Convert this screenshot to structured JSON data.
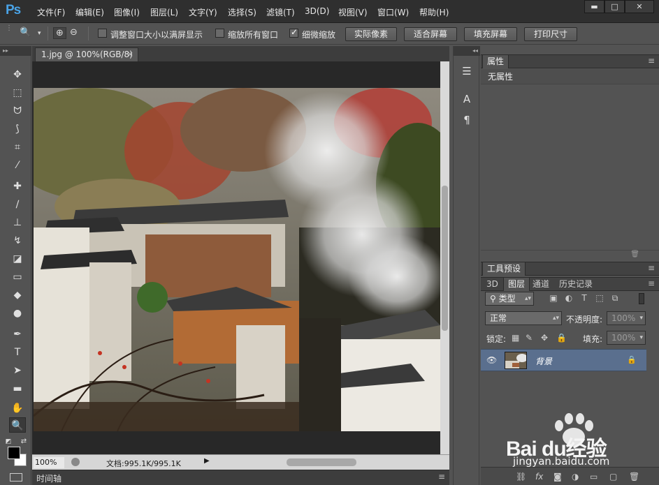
{
  "app": {
    "logo": "Ps"
  },
  "menu": [
    "文件(F)",
    "编辑(E)",
    "图像(I)",
    "图层(L)",
    "文字(Y)",
    "选择(S)",
    "滤镜(T)",
    "3D(D)",
    "视图(V)",
    "窗口(W)",
    "帮助(H)"
  ],
  "window_controls": {
    "minimize": "▬",
    "maximize": "□",
    "close": "✕"
  },
  "options": {
    "chk_resize": {
      "label": "调整窗口大小以满屏显示",
      "checked": false
    },
    "chk_zoom_all": {
      "label": "缩放所有窗口",
      "checked": false
    },
    "chk_scrubby": {
      "label": "细微缩放",
      "checked": true
    },
    "btn_actual": "实际像素",
    "btn_fit": "适合屏幕",
    "btn_fill": "填充屏幕",
    "btn_print": "打印尺寸"
  },
  "document": {
    "tab_title": "1.jpg @ 100%(RGB/8)",
    "tab_close": "×",
    "zoom": "100%",
    "doc_info": "文档:995.1K/995.1K",
    "timeline_tab": "时间轴"
  },
  "properties_panel": {
    "tab": "属性",
    "body_title": "无属性"
  },
  "tool_presets_panel": {
    "tab": "工具预设"
  },
  "layers_panel": {
    "tabs": [
      "3D",
      "图层",
      "通道",
      "历史记录"
    ],
    "active_tab": "图层",
    "filter_kind": "类型",
    "blend_mode": "正常",
    "opacity_label": "不透明度:",
    "opacity_value": "100%",
    "lock_label": "锁定:",
    "fill_label": "填充:",
    "fill_value": "100%",
    "layers": [
      {
        "name": "背景",
        "visible": true,
        "locked": true,
        "selected": true
      }
    ]
  },
  "watermark": {
    "brand": "Bai du经验",
    "url": "jingyan.baidu.com"
  },
  "colors": {
    "foreground": "#000000",
    "background": "#ffffff",
    "selected_layer": "#5a6f8e"
  }
}
